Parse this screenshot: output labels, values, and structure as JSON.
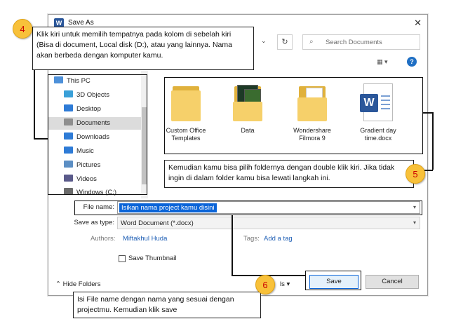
{
  "window": {
    "title": "Save As",
    "logo_letter": "W",
    "close": "✕"
  },
  "search": {
    "placeholder": "Search Documents"
  },
  "icons": {
    "refresh": "↻",
    "chevron_down": "⌄",
    "view": "▦ ▾",
    "help": "?",
    "search": "⌕"
  },
  "nav": {
    "items": [
      {
        "label": "This PC",
        "color": "#4d90d9"
      },
      {
        "label": "3D Objects",
        "color": "#3aa0d8"
      },
      {
        "label": "Desktop",
        "color": "#2e7bd6"
      },
      {
        "label": "Documents",
        "color": "#8e8e8e"
      },
      {
        "label": "Downloads",
        "color": "#2e7bd6"
      },
      {
        "label": "Music",
        "color": "#2e7bd6"
      },
      {
        "label": "Pictures",
        "color": "#5c8fc4"
      },
      {
        "label": "Videos",
        "color": "#5a5a8a"
      },
      {
        "label": "Windows (C:)",
        "color": "#6b6b6b"
      }
    ]
  },
  "files": [
    {
      "label": "Custom Office Templates",
      "type": "folder"
    },
    {
      "label": "Data",
      "type": "image-folder"
    },
    {
      "label": "Wondershare Filmora 9",
      "type": "folder"
    },
    {
      "label": "Gradient day time.docx",
      "type": "docx"
    }
  ],
  "form": {
    "file_name_label": "File name:",
    "file_name_value": "Isikan nama project kamu disini",
    "save_type_label": "Save as type:",
    "save_type_value": "Word Document (*.docx)",
    "authors_label": "Authors:",
    "authors_value": "Miftakhul Huda",
    "tags_label": "Tags:",
    "tags_value": "Add a tag",
    "thumbnail_label": "Save Thumbnail",
    "hide_folders_label": "Hide Folders",
    "tools_fragment": "ls",
    "save_label": "Save",
    "cancel_label": "Cancel"
  },
  "callouts": {
    "c4": {
      "number": "4",
      "text": "Klik kiri untuk memilih tempatnya pada kolom di sebelah kiri (Bisa di document, Local disk (D:), atau yang lainnya. Nama akan berbeda dengan komputer kamu."
    },
    "c5": {
      "number": "5",
      "text": "Kemudian kamu bisa pilih foldernya dengan double klik kiri. Jika tidak ingin di dalam folder kamu bisa lewati langkah ini."
    },
    "c6": {
      "number": "6",
      "text": "Isi File name dengan nama yang sesuai dengan projectmu. Kemudian klik save"
    }
  },
  "colors": {
    "accent": "#0a64d8",
    "badge": "#f8c13a",
    "badge_text": "#cc0000"
  }
}
